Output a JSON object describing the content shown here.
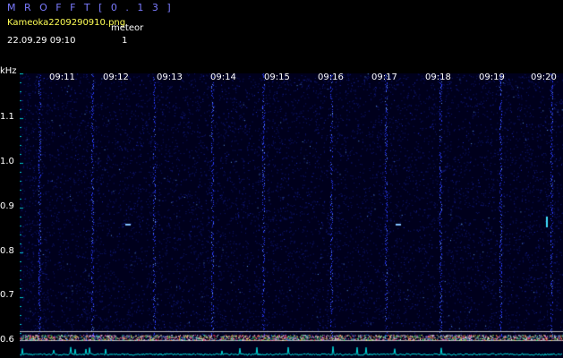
{
  "header": {
    "title": "M R O F F T  [ 0 . 1 3 ]",
    "filename": "Kameoka2209290910.png",
    "datetime": "22.09.29  09:10",
    "meteor_label": "meteor",
    "meteor_count": "1"
  },
  "axis": {
    "y_unit": "kHz",
    "y_ticks": [
      "1.1",
      "1.0",
      "0.9",
      "0.8",
      "0.7",
      "0.6"
    ],
    "x_ticks": [
      "09:11",
      "09:12",
      "09:13",
      "09:14",
      "09:15",
      "09:16",
      "09:17",
      "09:18",
      "09:19",
      "09:20"
    ]
  },
  "colors": {
    "background": "#000000",
    "spectrogram_bg": "#00001c",
    "title": "#7b7bff",
    "filename": "#ffff55",
    "axis_tick": "#00c0c0",
    "band_line": "#bbbbbb",
    "trace": "#00e0e0"
  }
}
